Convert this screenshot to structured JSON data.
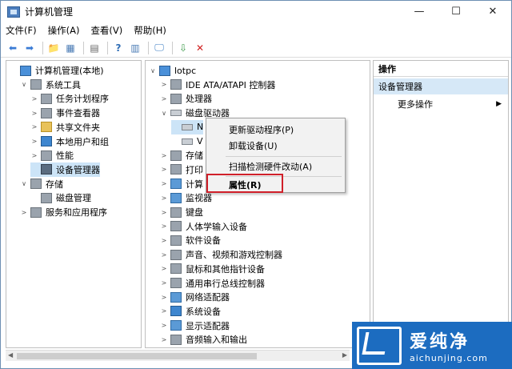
{
  "window": {
    "title": "计算机管理",
    "minimize": "—",
    "maximize": "☐",
    "close": "✕"
  },
  "menubar": [
    "文件(F)",
    "操作(A)",
    "查看(V)",
    "帮助(H)"
  ],
  "toolbar": {
    "icons": [
      "back-icon",
      "forward-icon",
      "up-icon",
      "show-hide-tree-icon",
      "properties-icon",
      "help-icon",
      "view-icon",
      "monitor-icon",
      "update-driver-icon",
      "delete-icon"
    ]
  },
  "left_tree": [
    {
      "label": "计算机管理(本地)",
      "indent": 0,
      "twisty": "",
      "icon": "computer-management-icon"
    },
    {
      "label": "系统工具",
      "indent": 1,
      "twisty": "∨",
      "icon": "system-tools-icon"
    },
    {
      "label": "任务计划程序",
      "indent": 2,
      "twisty": ">",
      "icon": "task-scheduler-icon"
    },
    {
      "label": "事件查看器",
      "indent": 2,
      "twisty": ">",
      "icon": "event-viewer-icon"
    },
    {
      "label": "共享文件夹",
      "indent": 2,
      "twisty": ">",
      "icon": "shared-folders-icon"
    },
    {
      "label": "本地用户和组",
      "indent": 2,
      "twisty": ">",
      "icon": "local-users-icon"
    },
    {
      "label": "性能",
      "indent": 2,
      "twisty": ">",
      "icon": "performance-icon"
    },
    {
      "label": "设备管理器",
      "indent": 2,
      "twisty": "",
      "icon": "device-manager-icon",
      "selected": true
    },
    {
      "label": "存储",
      "indent": 1,
      "twisty": "∨",
      "icon": "storage-icon"
    },
    {
      "label": "磁盘管理",
      "indent": 2,
      "twisty": "",
      "icon": "disk-management-icon"
    },
    {
      "label": "服务和应用程序",
      "indent": 1,
      "twisty": ">",
      "icon": "services-icon"
    }
  ],
  "mid_tree": [
    {
      "label": "lotpc",
      "indent": 0,
      "twisty": "∨",
      "icon": "computer-icon"
    },
    {
      "label": "IDE ATA/ATAPI 控制器",
      "indent": 1,
      "twisty": ">",
      "icon": "ide-controller-icon"
    },
    {
      "label": "处理器",
      "indent": 1,
      "twisty": ">",
      "icon": "processor-icon"
    },
    {
      "label": "磁盘驱动器",
      "indent": 1,
      "twisty": "∨",
      "icon": "disk-drive-icon"
    },
    {
      "label": "N",
      "indent": 2,
      "twisty": "",
      "icon": "drive-icon",
      "selected": true
    },
    {
      "label": "V",
      "indent": 2,
      "twisty": "",
      "icon": "drive-icon"
    },
    {
      "label": "存储",
      "indent": 1,
      "twisty": ">",
      "icon": "storage-controller-icon"
    },
    {
      "label": "打印",
      "indent": 1,
      "twisty": ">",
      "icon": "print-queue-icon"
    },
    {
      "label": "计算",
      "indent": 1,
      "twisty": ">",
      "icon": "computer-category-icon"
    },
    {
      "label": "监视器",
      "indent": 1,
      "twisty": ">",
      "icon": "monitor-category-icon"
    },
    {
      "label": "键盘",
      "indent": 1,
      "twisty": ">",
      "icon": "keyboard-icon"
    },
    {
      "label": "人体学输入设备",
      "indent": 1,
      "twisty": ">",
      "icon": "hid-icon"
    },
    {
      "label": "软件设备",
      "indent": 1,
      "twisty": ">",
      "icon": "software-device-icon"
    },
    {
      "label": "声音、视频和游戏控制器",
      "indent": 1,
      "twisty": ">",
      "icon": "sound-icon"
    },
    {
      "label": "鼠标和其他指针设备",
      "indent": 1,
      "twisty": ">",
      "icon": "mouse-icon"
    },
    {
      "label": "通用串行总线控制器",
      "indent": 1,
      "twisty": ">",
      "icon": "usb-icon"
    },
    {
      "label": "网络适配器",
      "indent": 1,
      "twisty": ">",
      "icon": "network-adapter-icon"
    },
    {
      "label": "系统设备",
      "indent": 1,
      "twisty": ">",
      "icon": "system-device-icon"
    },
    {
      "label": "显示适配器",
      "indent": 1,
      "twisty": ">",
      "icon": "display-adapter-icon"
    },
    {
      "label": "音频输入和输出",
      "indent": 1,
      "twisty": ">",
      "icon": "audio-io-icon"
    }
  ],
  "context_menu": {
    "items": [
      "更新驱动程序(P)",
      "卸载设备(U)",
      "扫描检测硬件改动(A)",
      "属性(R)"
    ],
    "highlighted": "属性(R)"
  },
  "actions_pane": {
    "header": "操作",
    "section": "设备管理器",
    "more": "更多操作",
    "more_arrow": "▶"
  },
  "watermark": {
    "title": "爱纯净",
    "url": "aichunjing.com"
  }
}
